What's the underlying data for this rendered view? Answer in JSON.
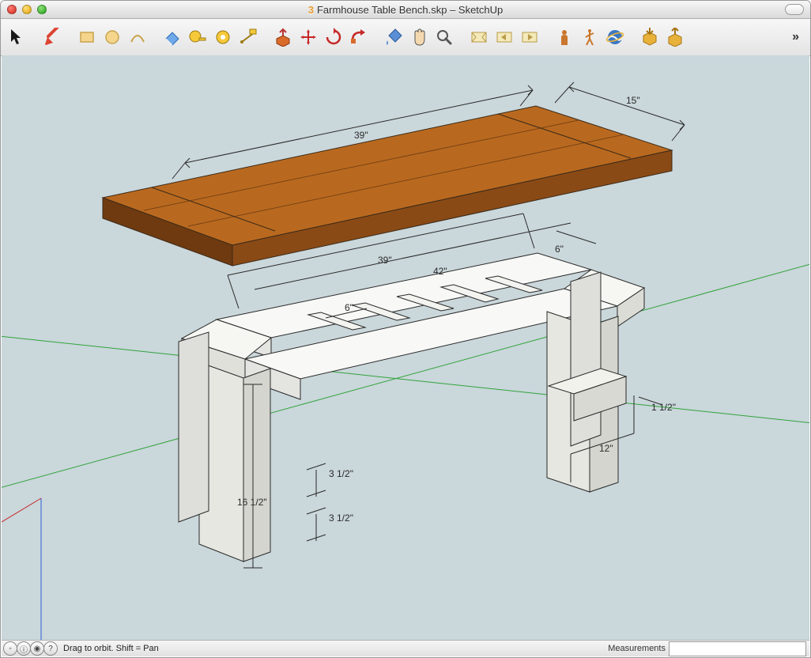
{
  "window": {
    "title_prefix": "3",
    "title": "Farmhouse Table Bench.skp – SketchUp"
  },
  "toolbar": {
    "tools": [
      "select-tool",
      "pencil-tool",
      "rectangle-tool",
      "circle-tool",
      "arc-tool",
      "eraser-tool",
      "tape-measure-tool",
      "protractor-tool",
      "text-tool",
      "push-pull-tool",
      "move-tool",
      "rotate-tool",
      "follow-me-tool",
      "paint-bucket-tool",
      "hand-tool",
      "zoom-tool",
      "zoom-extents-tool",
      "previous-view-tool",
      "next-view-tool",
      "person-tool",
      "walk-tool",
      "google-earth-tool",
      "get-models-tool",
      "share-model-tool"
    ],
    "overflow": "»"
  },
  "dimensions": {
    "seat_length": "39\"",
    "seat_width": "15\"",
    "frame_a": "39\"",
    "frame_b": "42\"",
    "frame_c": "6\"",
    "frame_slat": "6\"",
    "stretcher1": "3 1/2\"",
    "stretcher2": "3 1/2\"",
    "leg_height": "16 1/2\"",
    "end_depth": "12\"",
    "end_thick": "1 1/2\""
  },
  "status": {
    "hint": "Drag to orbit.  Shift = Pan",
    "measurements_label": "Measurements",
    "measurements_value": ""
  }
}
